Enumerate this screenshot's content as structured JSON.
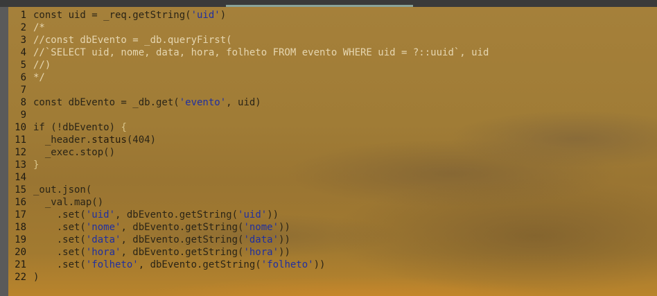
{
  "editor": {
    "lines": [
      {
        "n": "1",
        "parts": [
          {
            "t": "const uid = _req.getString(",
            "k": "txt"
          },
          {
            "t": "'uid'",
            "k": "s"
          },
          {
            "t": ")",
            "k": "txt"
          }
        ]
      },
      {
        "n": "2",
        "parts": [
          {
            "t": "/*",
            "k": "c"
          }
        ]
      },
      {
        "n": "3",
        "parts": [
          {
            "t": "//const dbEvento = _db.queryFirst(",
            "k": "c"
          }
        ]
      },
      {
        "n": "4",
        "parts": [
          {
            "t": "//`SELECT uid, nome, data, hora, folheto FROM evento WHERE uid = ?::uuid`, uid",
            "k": "c"
          }
        ]
      },
      {
        "n": "5",
        "parts": [
          {
            "t": "//)",
            "k": "c"
          }
        ]
      },
      {
        "n": "6",
        "parts": [
          {
            "t": "*/",
            "k": "c"
          }
        ]
      },
      {
        "n": "7",
        "parts": []
      },
      {
        "n": "8",
        "parts": [
          {
            "t": "const dbEvento = _db.get(",
            "k": "txt"
          },
          {
            "t": "'evento'",
            "k": "s"
          },
          {
            "t": ", uid)",
            "k": "txt"
          }
        ]
      },
      {
        "n": "9",
        "parts": []
      },
      {
        "n": "10",
        "parts": [
          {
            "t": "if (!dbEvento) ",
            "k": "txt"
          },
          {
            "t": "{",
            "k": "brace"
          }
        ]
      },
      {
        "n": "11",
        "parts": [
          {
            "t": "  _header.",
            "k": "txt"
          },
          {
            "t": "status",
            "k": "fn"
          },
          {
            "t": "(404)",
            "k": "txt"
          }
        ]
      },
      {
        "n": "12",
        "parts": [
          {
            "t": "  _exec.stop()",
            "k": "txt"
          }
        ]
      },
      {
        "n": "13",
        "parts": [
          {
            "t": "}",
            "k": "brace"
          }
        ]
      },
      {
        "n": "14",
        "parts": []
      },
      {
        "n": "15",
        "parts": [
          {
            "t": "_out.json(",
            "k": "txt"
          }
        ]
      },
      {
        "n": "16",
        "parts": [
          {
            "t": "  _val.map()",
            "k": "txt"
          }
        ]
      },
      {
        "n": "17",
        "parts": [
          {
            "t": "    .set(",
            "k": "txt"
          },
          {
            "t": "'uid'",
            "k": "s"
          },
          {
            "t": ", dbEvento.getString(",
            "k": "txt"
          },
          {
            "t": "'uid'",
            "k": "s"
          },
          {
            "t": "))",
            "k": "txt"
          }
        ]
      },
      {
        "n": "18",
        "parts": [
          {
            "t": "    .set(",
            "k": "txt"
          },
          {
            "t": "'nome'",
            "k": "s"
          },
          {
            "t": ", dbEvento.getString(",
            "k": "txt"
          },
          {
            "t": "'nome'",
            "k": "s"
          },
          {
            "t": "))",
            "k": "txt"
          }
        ]
      },
      {
        "n": "19",
        "parts": [
          {
            "t": "    .set(",
            "k": "txt"
          },
          {
            "t": "'data'",
            "k": "s"
          },
          {
            "t": ", dbEvento.getString(",
            "k": "txt"
          },
          {
            "t": "'data'",
            "k": "s"
          },
          {
            "t": "))",
            "k": "txt"
          }
        ]
      },
      {
        "n": "20",
        "parts": [
          {
            "t": "    .set(",
            "k": "txt"
          },
          {
            "t": "'hora'",
            "k": "s"
          },
          {
            "t": ", dbEvento.getString(",
            "k": "txt"
          },
          {
            "t": "'hora'",
            "k": "s"
          },
          {
            "t": "))",
            "k": "txt"
          }
        ]
      },
      {
        "n": "21",
        "parts": [
          {
            "t": "    .set(",
            "k": "txt"
          },
          {
            "t": "'folheto'",
            "k": "s"
          },
          {
            "t": ", dbEvento.getString(",
            "k": "txt"
          },
          {
            "t": "'folheto'",
            "k": "s"
          },
          {
            "t": "))",
            "k": "txt"
          }
        ]
      },
      {
        "n": "22",
        "parts": [
          {
            "t": ")",
            "k": "txt"
          }
        ]
      }
    ]
  }
}
